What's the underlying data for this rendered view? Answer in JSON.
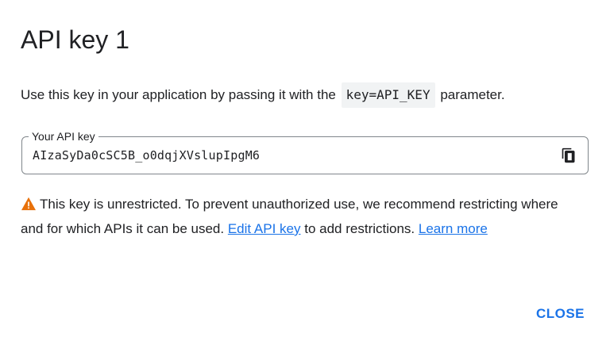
{
  "dialog": {
    "title": "API key 1",
    "instruction": {
      "before": "Use this key in your application by passing it with the",
      "code": "key=API_KEY",
      "after": "parameter."
    },
    "api_key_field": {
      "label": "Your API key",
      "value": "AIzaSyDa0cSC5B_o0dqjXVslupIpgM6",
      "copy_icon": "copy-icon"
    },
    "warning": {
      "icon": "warning-icon",
      "icon_color": "#e8710a",
      "text_before": "This key is unrestricted. To prevent unauthorized use, we recommend restricting where and for which APIs it can be used.",
      "edit_link": "Edit API key",
      "text_middle": "to add restrictions.",
      "learn_more_link": "Learn more"
    },
    "close_label": "CLOSE"
  },
  "colors": {
    "accent": "#1a73e8",
    "text": "#202124",
    "border": "#80868b",
    "warning": "#e8710a"
  }
}
